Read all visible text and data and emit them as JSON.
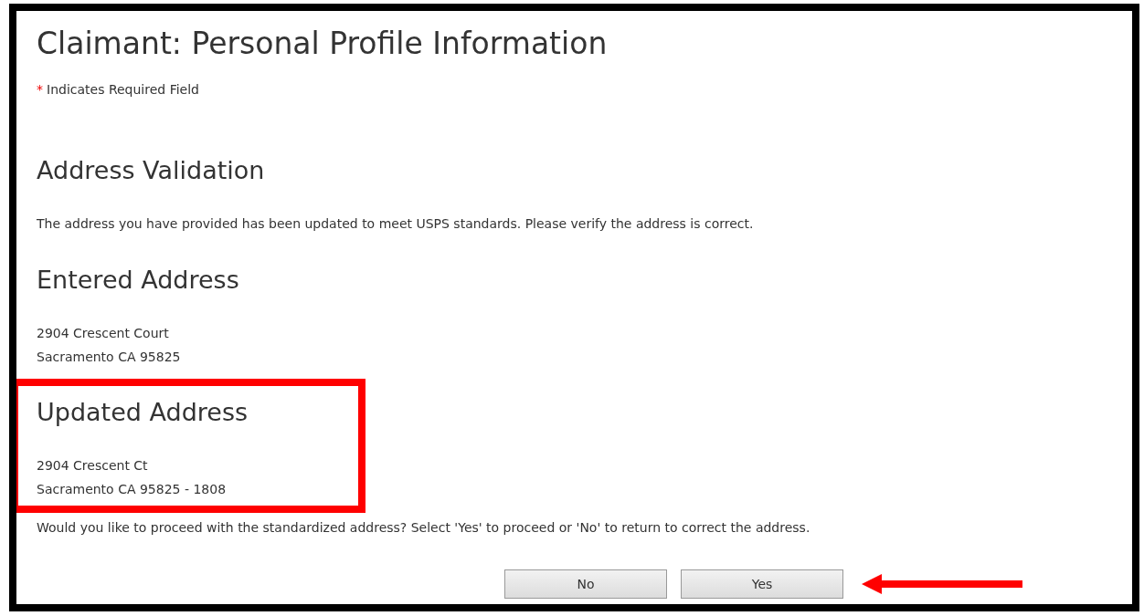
{
  "title": "Claimant: Personal Profile Information",
  "required_note": {
    "marker": "*",
    "text": "Indicates Required Field"
  },
  "sections": [
    {
      "heading": "Address Validation",
      "lines": [
        "The address you have provided has been updated to meet USPS standards. Please verify the address is correct."
      ],
      "highlighted": false
    },
    {
      "heading": "Entered Address",
      "lines": [
        "2904 Crescent Court",
        "Sacramento CA 95825"
      ],
      "highlighted": false
    },
    {
      "heading": "Updated Address",
      "lines": [
        "2904 Crescent Ct",
        "Sacramento CA 95825 - 1808"
      ],
      "highlighted": true
    }
  ],
  "question": "Would you like to proceed with the standardized address? Select 'Yes' to proceed or 'No' to return to correct the address.",
  "buttons": [
    {
      "label": "No",
      "pointed": false
    },
    {
      "label": "Yes",
      "pointed": true
    }
  ]
}
